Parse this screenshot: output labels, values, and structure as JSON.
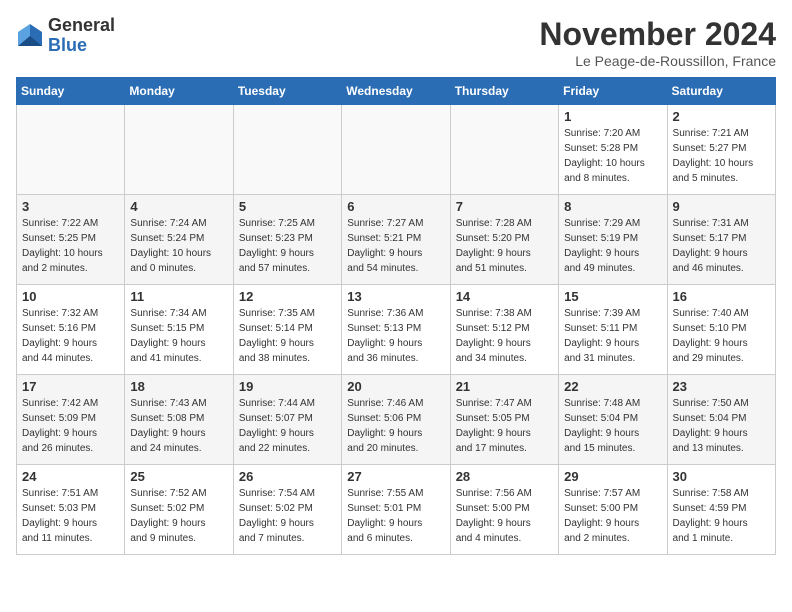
{
  "logo": {
    "general": "General",
    "blue": "Blue"
  },
  "header": {
    "month": "November 2024",
    "location": "Le Peage-de-Roussillon, France"
  },
  "weekdays": [
    "Sunday",
    "Monday",
    "Tuesday",
    "Wednesday",
    "Thursday",
    "Friday",
    "Saturday"
  ],
  "weeks": [
    [
      {
        "day": "",
        "info": ""
      },
      {
        "day": "",
        "info": ""
      },
      {
        "day": "",
        "info": ""
      },
      {
        "day": "",
        "info": ""
      },
      {
        "day": "",
        "info": ""
      },
      {
        "day": "1",
        "info": "Sunrise: 7:20 AM\nSunset: 5:28 PM\nDaylight: 10 hours\nand 8 minutes."
      },
      {
        "day": "2",
        "info": "Sunrise: 7:21 AM\nSunset: 5:27 PM\nDaylight: 10 hours\nand 5 minutes."
      }
    ],
    [
      {
        "day": "3",
        "info": "Sunrise: 7:22 AM\nSunset: 5:25 PM\nDaylight: 10 hours\nand 2 minutes."
      },
      {
        "day": "4",
        "info": "Sunrise: 7:24 AM\nSunset: 5:24 PM\nDaylight: 10 hours\nand 0 minutes."
      },
      {
        "day": "5",
        "info": "Sunrise: 7:25 AM\nSunset: 5:23 PM\nDaylight: 9 hours\nand 57 minutes."
      },
      {
        "day": "6",
        "info": "Sunrise: 7:27 AM\nSunset: 5:21 PM\nDaylight: 9 hours\nand 54 minutes."
      },
      {
        "day": "7",
        "info": "Sunrise: 7:28 AM\nSunset: 5:20 PM\nDaylight: 9 hours\nand 51 minutes."
      },
      {
        "day": "8",
        "info": "Sunrise: 7:29 AM\nSunset: 5:19 PM\nDaylight: 9 hours\nand 49 minutes."
      },
      {
        "day": "9",
        "info": "Sunrise: 7:31 AM\nSunset: 5:17 PM\nDaylight: 9 hours\nand 46 minutes."
      }
    ],
    [
      {
        "day": "10",
        "info": "Sunrise: 7:32 AM\nSunset: 5:16 PM\nDaylight: 9 hours\nand 44 minutes."
      },
      {
        "day": "11",
        "info": "Sunrise: 7:34 AM\nSunset: 5:15 PM\nDaylight: 9 hours\nand 41 minutes."
      },
      {
        "day": "12",
        "info": "Sunrise: 7:35 AM\nSunset: 5:14 PM\nDaylight: 9 hours\nand 38 minutes."
      },
      {
        "day": "13",
        "info": "Sunrise: 7:36 AM\nSunset: 5:13 PM\nDaylight: 9 hours\nand 36 minutes."
      },
      {
        "day": "14",
        "info": "Sunrise: 7:38 AM\nSunset: 5:12 PM\nDaylight: 9 hours\nand 34 minutes."
      },
      {
        "day": "15",
        "info": "Sunrise: 7:39 AM\nSunset: 5:11 PM\nDaylight: 9 hours\nand 31 minutes."
      },
      {
        "day": "16",
        "info": "Sunrise: 7:40 AM\nSunset: 5:10 PM\nDaylight: 9 hours\nand 29 minutes."
      }
    ],
    [
      {
        "day": "17",
        "info": "Sunrise: 7:42 AM\nSunset: 5:09 PM\nDaylight: 9 hours\nand 26 minutes."
      },
      {
        "day": "18",
        "info": "Sunrise: 7:43 AM\nSunset: 5:08 PM\nDaylight: 9 hours\nand 24 minutes."
      },
      {
        "day": "19",
        "info": "Sunrise: 7:44 AM\nSunset: 5:07 PM\nDaylight: 9 hours\nand 22 minutes."
      },
      {
        "day": "20",
        "info": "Sunrise: 7:46 AM\nSunset: 5:06 PM\nDaylight: 9 hours\nand 20 minutes."
      },
      {
        "day": "21",
        "info": "Sunrise: 7:47 AM\nSunset: 5:05 PM\nDaylight: 9 hours\nand 17 minutes."
      },
      {
        "day": "22",
        "info": "Sunrise: 7:48 AM\nSunset: 5:04 PM\nDaylight: 9 hours\nand 15 minutes."
      },
      {
        "day": "23",
        "info": "Sunrise: 7:50 AM\nSunset: 5:04 PM\nDaylight: 9 hours\nand 13 minutes."
      }
    ],
    [
      {
        "day": "24",
        "info": "Sunrise: 7:51 AM\nSunset: 5:03 PM\nDaylight: 9 hours\nand 11 minutes."
      },
      {
        "day": "25",
        "info": "Sunrise: 7:52 AM\nSunset: 5:02 PM\nDaylight: 9 hours\nand 9 minutes."
      },
      {
        "day": "26",
        "info": "Sunrise: 7:54 AM\nSunset: 5:02 PM\nDaylight: 9 hours\nand 7 minutes."
      },
      {
        "day": "27",
        "info": "Sunrise: 7:55 AM\nSunset: 5:01 PM\nDaylight: 9 hours\nand 6 minutes."
      },
      {
        "day": "28",
        "info": "Sunrise: 7:56 AM\nSunset: 5:00 PM\nDaylight: 9 hours\nand 4 minutes."
      },
      {
        "day": "29",
        "info": "Sunrise: 7:57 AM\nSunset: 5:00 PM\nDaylight: 9 hours\nand 2 minutes."
      },
      {
        "day": "30",
        "info": "Sunrise: 7:58 AM\nSunset: 4:59 PM\nDaylight: 9 hours\nand 1 minute."
      }
    ]
  ]
}
